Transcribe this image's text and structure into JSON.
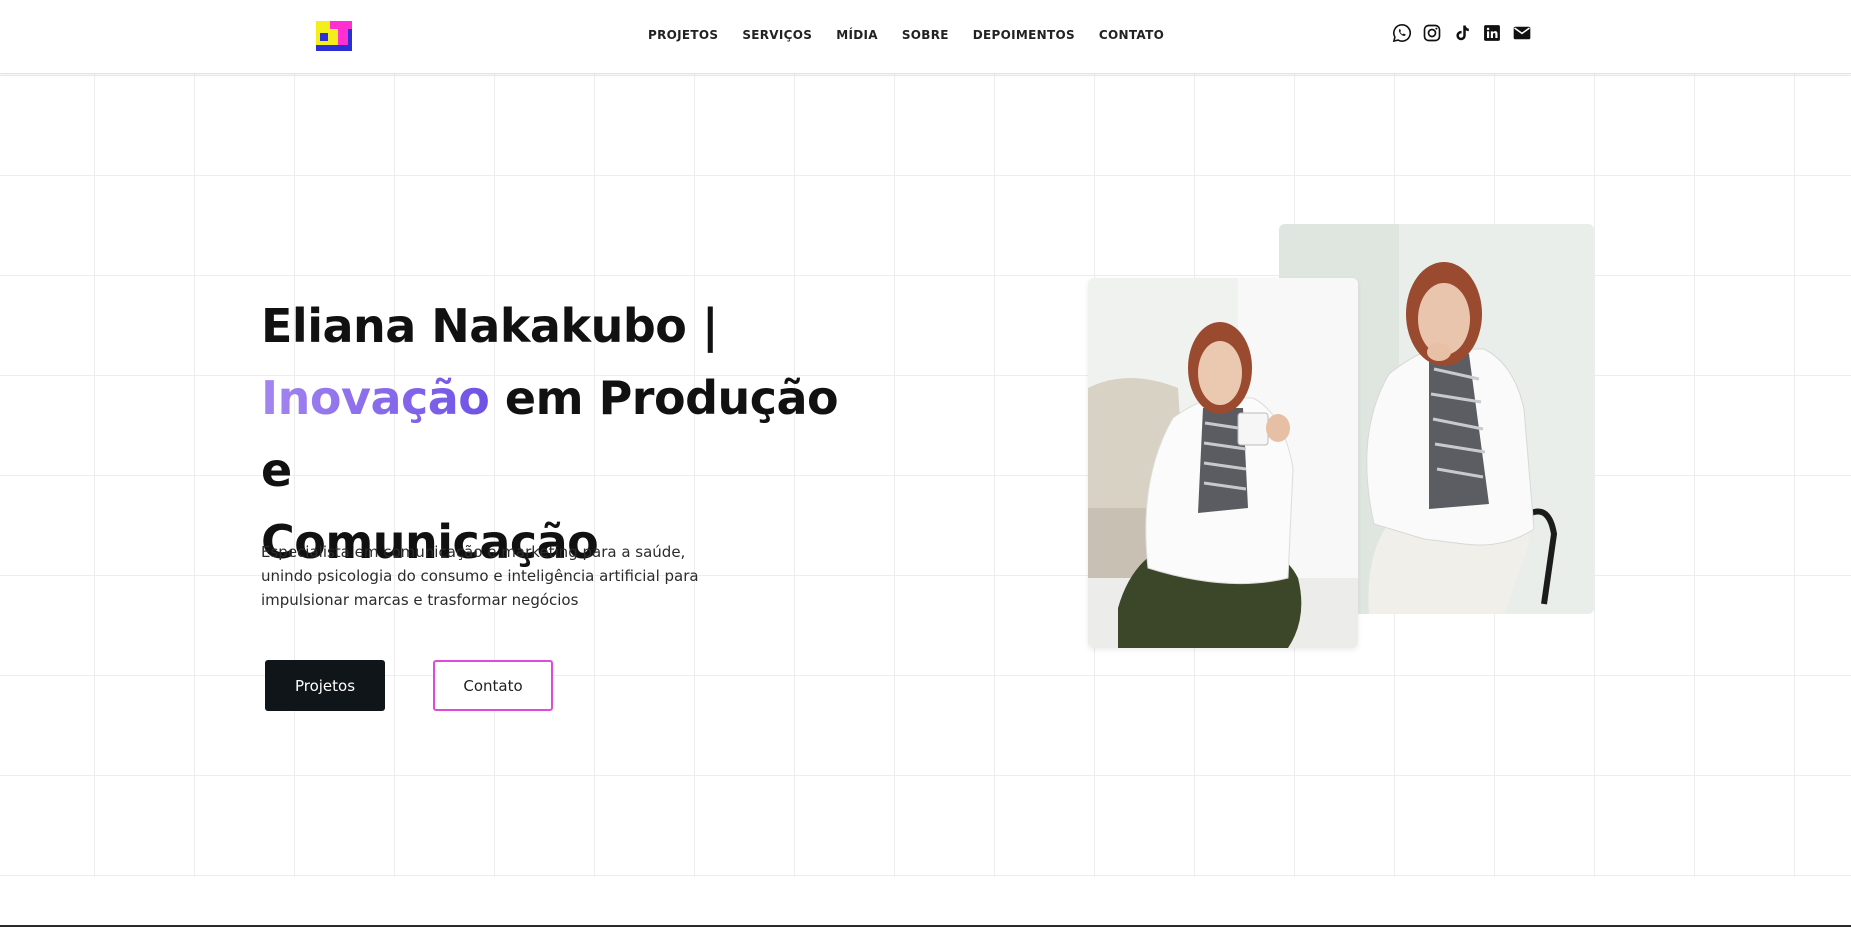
{
  "header": {
    "logo_name": "logo-et",
    "nav": [
      {
        "label": "PROJETOS"
      },
      {
        "label": "SERVIÇOS"
      },
      {
        "label": "MÍDIA"
      },
      {
        "label": "SOBRE"
      },
      {
        "label": "DEPOIMENTOS"
      },
      {
        "label": "CONTATO"
      }
    ],
    "social": [
      {
        "icon": "whatsapp-icon"
      },
      {
        "icon": "instagram-icon"
      },
      {
        "icon": "tiktok-icon"
      },
      {
        "icon": "linkedin-icon"
      },
      {
        "icon": "email-icon"
      }
    ]
  },
  "hero": {
    "title_part1": "Eliana Nakakubo |",
    "title_accent": "Inovação",
    "title_part2": " em Produção e",
    "title_part3": "Comunicação",
    "subtitle": "Especialista em comunicação e marketing para a saúde, unindo psicologia do consumo e inteligência artificial para impulsionar marcas e trasformar negócios",
    "primary_button": "Projetos",
    "secondary_button": "Contato"
  },
  "colors": {
    "accent_gradient_start": "#a486f0",
    "accent_gradient_end": "#6f52e6",
    "primary_button_bg": "#10151a",
    "outline_button_border": "#e04ad8",
    "grid_line": "#ededed"
  }
}
